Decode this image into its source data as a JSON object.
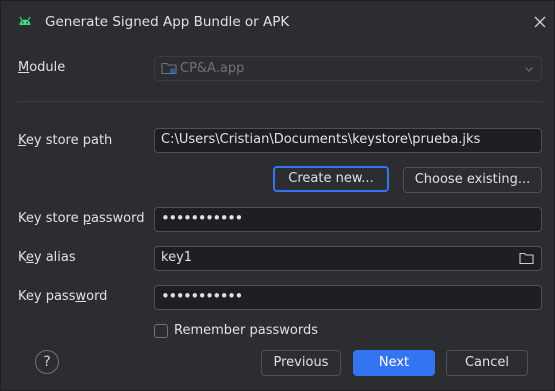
{
  "window": {
    "title": "Generate Signed App Bundle or APK",
    "app_icon": "android-icon",
    "close_icon": "close-icon"
  },
  "module": {
    "label_pre": "",
    "label_ul": "M",
    "label_post": "odule",
    "value": "CP&A.app",
    "icon": "module-folder-icon"
  },
  "key_store_path": {
    "label_pre": "",
    "label_ul": "K",
    "label_post": "ey store path",
    "value": "C:\\Users\\Cristian\\Documents\\keystore\\prueba.jks"
  },
  "buttons": {
    "create_new": "Create new...",
    "choose_existing": "Choose existing...",
    "previous": "Previous",
    "next": "Next",
    "cancel": "Cancel"
  },
  "key_store_password": {
    "label_pre": "Key store ",
    "label_ul": "p",
    "label_post": "assword",
    "value": "•••••••••••"
  },
  "key_alias": {
    "label_pre": "K",
    "label_ul": "e",
    "label_post": "y alias",
    "value": "key1"
  },
  "key_password": {
    "label_pre": "Key pass",
    "label_ul": "w",
    "label_post": "ord",
    "value": "•••••••••••"
  },
  "remember": {
    "label": "Remember passwords",
    "checked": false
  },
  "help": {
    "glyph": "?"
  },
  "colors": {
    "background": "#2b2d30",
    "accent": "#3574f0",
    "field_bg": "#1e1f22",
    "border": "#4e5157",
    "text": "#dfe1e5",
    "disabled_text": "#6f737a",
    "android_green": "#3ddc84"
  }
}
